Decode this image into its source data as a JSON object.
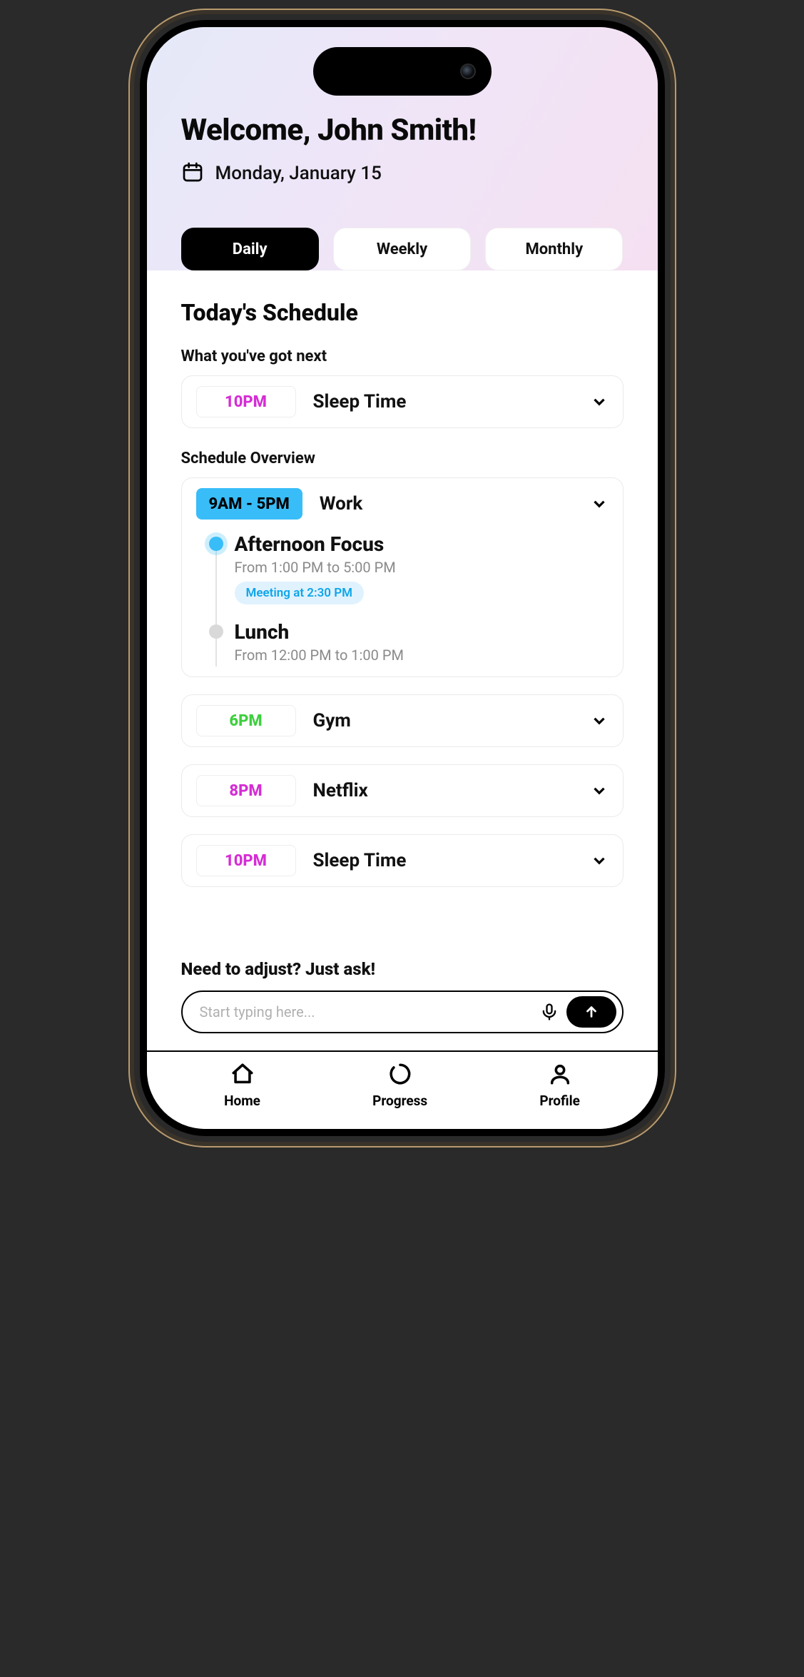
{
  "header": {
    "welcome": "Welcome, John Smith!",
    "date": "Monday, January 15"
  },
  "tabs": {
    "daily": "Daily",
    "weekly": "Weekly",
    "monthly": "Monthly"
  },
  "schedule": {
    "title": "Today's Schedule",
    "next_label": "What you've got next",
    "next": {
      "time": "10PM",
      "title": "Sleep Time"
    },
    "overview_label": "Schedule Overview",
    "items": [
      {
        "time": "9AM - 5PM",
        "title": "Work",
        "expanded": true,
        "sub": [
          {
            "title": "Afternoon Focus",
            "time": "From 1:00 PM to 5:00 PM",
            "badge": "Meeting at 2:30 PM",
            "active": true
          },
          {
            "title": "Lunch",
            "time": "From 12:00 PM to 1:00 PM"
          }
        ]
      },
      {
        "time": "6PM",
        "title": "Gym",
        "color": "green"
      },
      {
        "time": "8PM",
        "title": "Netflix",
        "color": "pink"
      },
      {
        "time": "10PM",
        "title": "Sleep Time",
        "color": "pink"
      }
    ]
  },
  "ask": {
    "title": "Need to adjust? Just ask!",
    "placeholder": "Start typing here..."
  },
  "nav": {
    "home": "Home",
    "progress": "Progress",
    "profile": "Profile"
  }
}
